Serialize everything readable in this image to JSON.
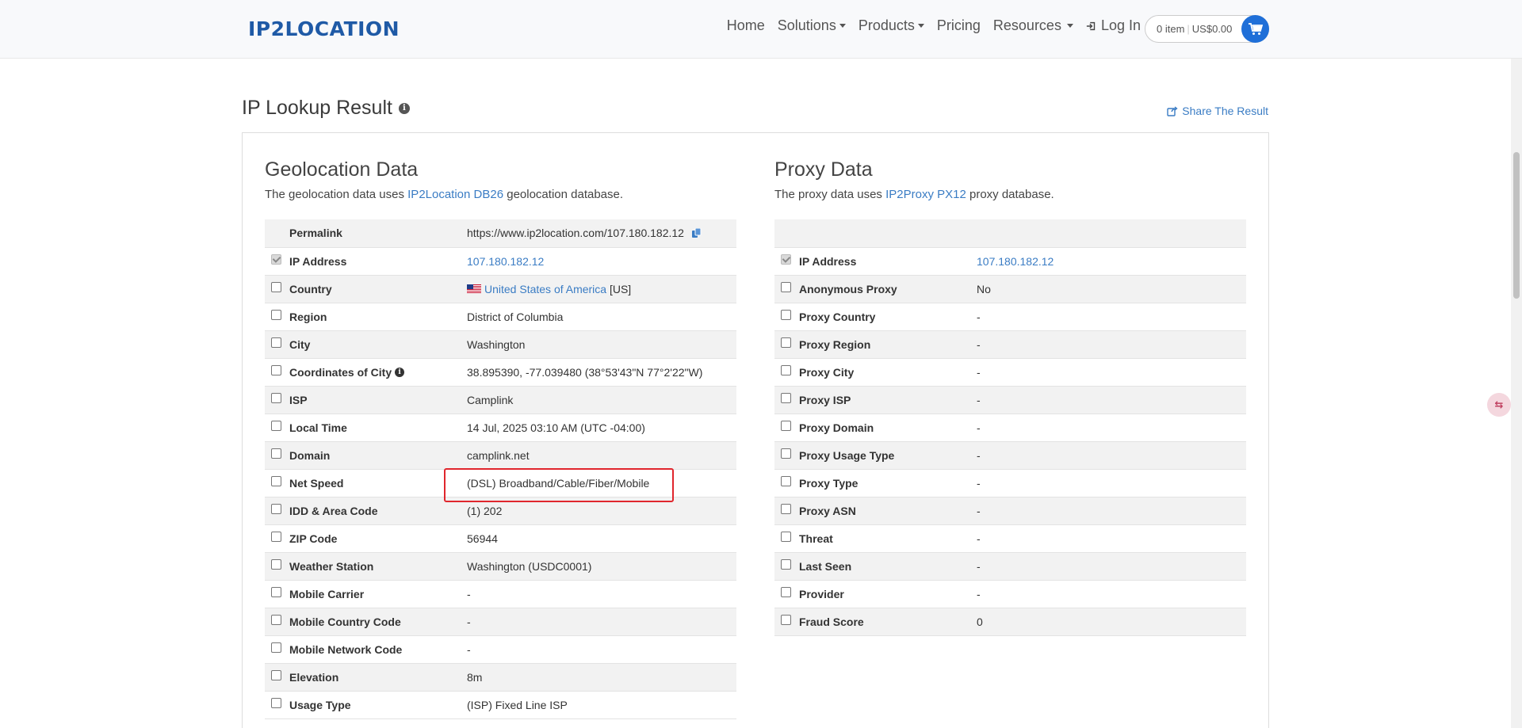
{
  "header": {
    "logo": "IP2LOCATION",
    "nav": [
      {
        "label": "Home",
        "dropdown": false
      },
      {
        "label": "Solutions",
        "dropdown": true
      },
      {
        "label": "Products",
        "dropdown": true
      },
      {
        "label": "Pricing",
        "dropdown": false
      },
      {
        "label": "Resources",
        "dropdown": true
      }
    ],
    "login_label": "Log In",
    "cart_items": "0 item",
    "cart_sep": "|",
    "cart_total": "US$0.00"
  },
  "page": {
    "title": "IP Lookup Result",
    "share_label": "Share The Result"
  },
  "geo": {
    "heading": "Geolocation Data",
    "desc_prefix": "The geolocation data uses",
    "desc_link": "IP2Location DB26",
    "desc_suffix": "geolocation database.",
    "rows": [
      {
        "label": "Permalink",
        "value": "https://www.ip2location.com/107.180.182.12"
      },
      {
        "label": "IP Address",
        "value": "107.180.182.12"
      },
      {
        "label": "Country",
        "value": "United States of America",
        "suffix": "[US]"
      },
      {
        "label": "Region",
        "value": "District of Columbia"
      },
      {
        "label": "City",
        "value": "Washington"
      },
      {
        "label": "Coordinates of City",
        "value": "38.895390, -77.039480 (38°53'43\"N   77°2'22\"W)"
      },
      {
        "label": "ISP",
        "value": "Camplink"
      },
      {
        "label": "Local Time",
        "value": "14 Jul, 2025 03:10 AM (UTC -04:00)"
      },
      {
        "label": "Domain",
        "value": "camplink.net"
      },
      {
        "label": "Net Speed",
        "value": "(DSL) Broadband/Cable/Fiber/Mobile"
      },
      {
        "label": "IDD & Area Code",
        "value": "(1) 202"
      },
      {
        "label": "ZIP Code",
        "value": "56944"
      },
      {
        "label": "Weather Station",
        "value": "Washington (USDC0001)"
      },
      {
        "label": "Mobile Carrier",
        "value": "-"
      },
      {
        "label": "Mobile Country Code",
        "value": "-"
      },
      {
        "label": "Mobile Network Code",
        "value": "-"
      },
      {
        "label": "Elevation",
        "value": "8m"
      },
      {
        "label": "Usage Type",
        "value": "(ISP) Fixed Line ISP"
      }
    ]
  },
  "proxy": {
    "heading": "Proxy Data",
    "desc_prefix": "The proxy data uses",
    "desc_link": "IP2Proxy PX12",
    "desc_suffix": "proxy database.",
    "rows": [
      {
        "label": "IP Address",
        "value": "107.180.182.12"
      },
      {
        "label": "Anonymous Proxy",
        "value": "No"
      },
      {
        "label": "Proxy Country",
        "value": "-"
      },
      {
        "label": "Proxy Region",
        "value": "-"
      },
      {
        "label": "Proxy City",
        "value": "-"
      },
      {
        "label": "Proxy ISP",
        "value": "-"
      },
      {
        "label": "Proxy Domain",
        "value": "-"
      },
      {
        "label": "Proxy Usage Type",
        "value": "-"
      },
      {
        "label": "Proxy Type",
        "value": "-"
      },
      {
        "label": "Proxy ASN",
        "value": "-"
      },
      {
        "label": "Threat",
        "value": "-"
      },
      {
        "label": "Last Seen",
        "value": "-"
      },
      {
        "label": "Provider",
        "value": "-"
      },
      {
        "label": "Fraud Score",
        "value": "0"
      }
    ]
  },
  "colors": {
    "brand": "#1f5aa6",
    "link": "#3a7cc4",
    "cart_button": "#1f6fd8",
    "highlight": "#e0262d"
  }
}
